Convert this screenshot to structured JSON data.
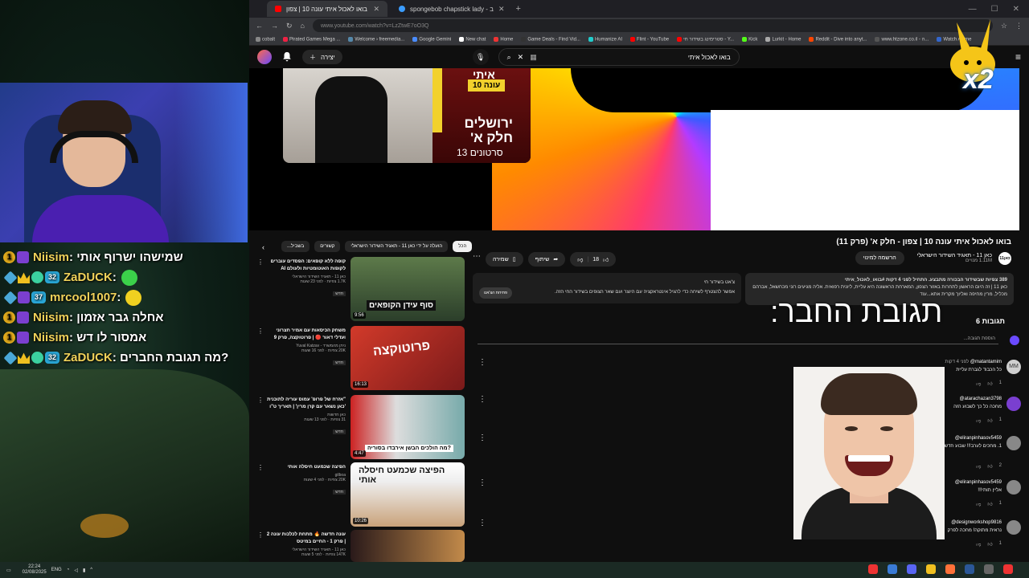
{
  "stream": {
    "chat": [
      {
        "badge": "1",
        "user": "Niisim",
        "msg": "שמישהו ישרוף אותי",
        "color": "#f0d25a"
      },
      {
        "badge_num": "32",
        "user": "ZaDUCK",
        "msg": "",
        "color": "#f0d25a"
      },
      {
        "badge_num": "37",
        "user": "mrcool1007",
        "msg": "",
        "color": "#f0d25a"
      },
      {
        "badge": "1",
        "user": "Niisim",
        "msg": "אחלה גבר אזמון",
        "color": "#f0d25a"
      },
      {
        "badge": "1",
        "user": "Niisim",
        "msg": "אמסור לו דש",
        "color": "#f0d25a"
      },
      {
        "badge_num": "32",
        "user": "ZaDUCK",
        "msg": "מה תגובת החברים?",
        "color": "#f0d25a"
      }
    ]
  },
  "browser": {
    "tabs": [
      {
        "label": "בואו לאכול איתי עונה 10 | צפון"
      },
      {
        "label": "spongebob chapstick lady - ב"
      }
    ],
    "url": "www.youtube.com/watch?v=LzZtwE7oO3Q",
    "bookmarks": [
      "cobalt",
      "Pirated Games Mega ...",
      "Welcome › freemedia...",
      "Google Gemini",
      "New chat",
      "Home",
      "Game Deals - Find Vid...",
      "Humanize AI",
      "Flint - YouTube",
      "סטרימינג בשידור חי - Y...",
      "Kick",
      "Lurkit - Home",
      "Reddit - Dive into anyt...",
      "www.htzone.co.il - ה...",
      "Watch Anime"
    ]
  },
  "youtube": {
    "create_label": "יצירה",
    "search_query": "בואו לאכול איתי",
    "playlist": {
      "tag": "עונה 10",
      "title_top": "איתי",
      "title": "ירושלים חלק א'",
      "count": "13 סרטונים"
    },
    "overlay_badge": "x2",
    "video_title": "בואו לאכול איתי עונה 10 | צפון - חלק א' (פרק 11)",
    "channel": {
      "name": "כאן 11 - תאגיד השידור הישראלי",
      "avatar_text": "כאן11",
      "subs": "1.11M מנויים",
      "subscribe": "הרשמה למינוי"
    },
    "actions": {
      "likes": "18",
      "share": "שיתוף",
      "save": "שמירה"
    },
    "description": {
      "meta": "389 צפיות שבשידור הבכורה מתבצע. התחיל לפני 4 דקות #בואו_לאכול_איתי",
      "text": "כאן 11 | זה היום הראשון לתחרות באזור הצפון, המארחת הראשונה היא עליית, ליונית רפואית. אליה מגיעים רוני מכחשאל, אברהם מכליל, מרין מחיפה ואליוך מקרית אתא...עוד"
    },
    "ai_box": {
      "title": "צ'אט בשידור חי",
      "text": "אפשר להצטרף לשיחה כדי להגיל אינטראקציה עם היוצר ועם שאר הצופים בשידור החי הזה.",
      "button": "פתיחת הצ'אט"
    },
    "comments_count": "6 תגובות",
    "overlay_caption": "תגובת החבר:",
    "add_comment": "הוספת תגובה...",
    "comments": [
      {
        "user": "matantamim@",
        "time": "לפני 4 דקות",
        "text": "כל הכבוד לגברת עליית",
        "likes": "1",
        "avatar": "MM",
        "color": "#cfcfcf"
      },
      {
        "user": "atarachazan3798@",
        "time": "",
        "text": "מחכה כל כך לשבוע הזה",
        "likes": "1",
        "avatar": "",
        "color": "#7a3fd0"
      },
      {
        "user": "eliranpinhasov5459@",
        "time": "",
        "text": "1. מחכים לערב!!! שבוע חדש!!!",
        "likes": "2",
        "avatar": "",
        "color": "#888"
      },
      {
        "user": "eliranpinhasov5459@",
        "time": "",
        "text": "אליין תותי!!!",
        "likes": "1",
        "avatar": "",
        "color": "#888"
      },
      {
        "user": "designworkshop9816@",
        "time": "",
        "text": "נראית מתוקה! מחכה לפרק",
        "likes": "1",
        "avatar": "",
        "color": "#888"
      }
    ],
    "sidebar": {
      "filters": [
        "הכל",
        "הועלה על ידי כאן 11 - תאגיד השידור הישראלי",
        "קשורים",
        "בשביל..."
      ],
      "videos": [
        {
          "title": "קופה ללא קופאים: הפסדים עוברים לקופות האוטומטיות ולעולם AI",
          "channel": "כאן 11 - תאגיד השידור הישראלי",
          "meta": "1.7K צפיות · לפני 23 שעות",
          "duration": "9:56",
          "overlay": "סוף עידן הקופאים",
          "new": "חדש"
        },
        {
          "title": "משחק הכיסאות עם אמיר חצרוני ועדלי דאור 🔴 | פרוטוקצה, פרק 9",
          "channel": "ניתן מהמשרד - Yuval Katzav",
          "meta": "20K צפיות · לפני 16 שעות",
          "duration": "16:13",
          "overlay": "פרוטוקצה",
          "new": "חדש"
        },
        {
          "title": "\"אזרח של פרופ' עמוס עוריה לתוכנית 'כאן נשאר עם קרן מרין' | תאריך ט\"ו",
          "channel": "כאן חדשות",
          "meta": "31 צפיות · לפני 13 שעות",
          "duration": "4:47",
          "overlay": "מה הולכים הבשן אירבדו בסוריה?",
          "new": "חדש"
        },
        {
          "title": "הפיצה שכמעט חיסלה אותי",
          "channel": "gilboa",
          "meta": "20K צפיות · לפני 4 שעות",
          "duration": "10:26",
          "overlay": "הפיצה שכמעט חיסלה אותי",
          "new": "חדש"
        },
        {
          "title": "עונה חדשה 🔥 מתחת לכלכות עונה 2 | פרק 1 - החיים במיטס",
          "channel": "כאן 11 - תאגיד השידור הישראלי",
          "meta": "147K צפיות · לפני 5 שעות",
          "duration": "",
          "overlay": "",
          "new": ""
        }
      ]
    }
  },
  "taskbar": {
    "time": "22:24",
    "date": "02/08/2025",
    "lang": "ENG"
  }
}
